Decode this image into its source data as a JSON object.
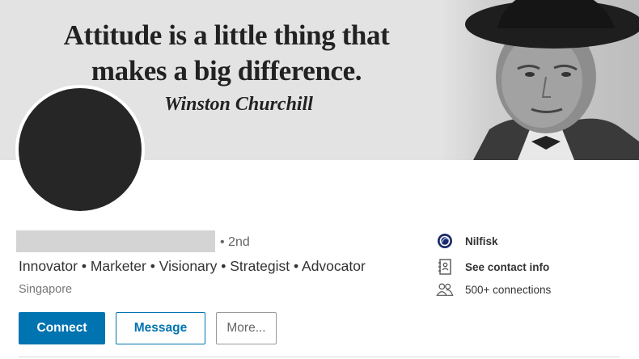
{
  "banner": {
    "quote_line1": "Attitude is a little thing that",
    "quote_line2": "makes a big difference.",
    "author": "Winston Churchill"
  },
  "profile": {
    "degree": "• 2nd",
    "headline": "Innovator • Marketer • Visionary • Strategist • Advocator",
    "location": "Singapore"
  },
  "actions": {
    "connect": "Connect",
    "message": "Message",
    "more": "More..."
  },
  "info": {
    "company": "Nilfisk",
    "contact": "See contact info",
    "connections": "500+ connections"
  },
  "icons": {
    "company": "company-logo-icon",
    "contact": "contact-card-icon",
    "connections": "people-icon"
  },
  "colors": {
    "accent": "#0073b1",
    "banner_bg": "#e3e3e3",
    "avatar": "#262626"
  }
}
